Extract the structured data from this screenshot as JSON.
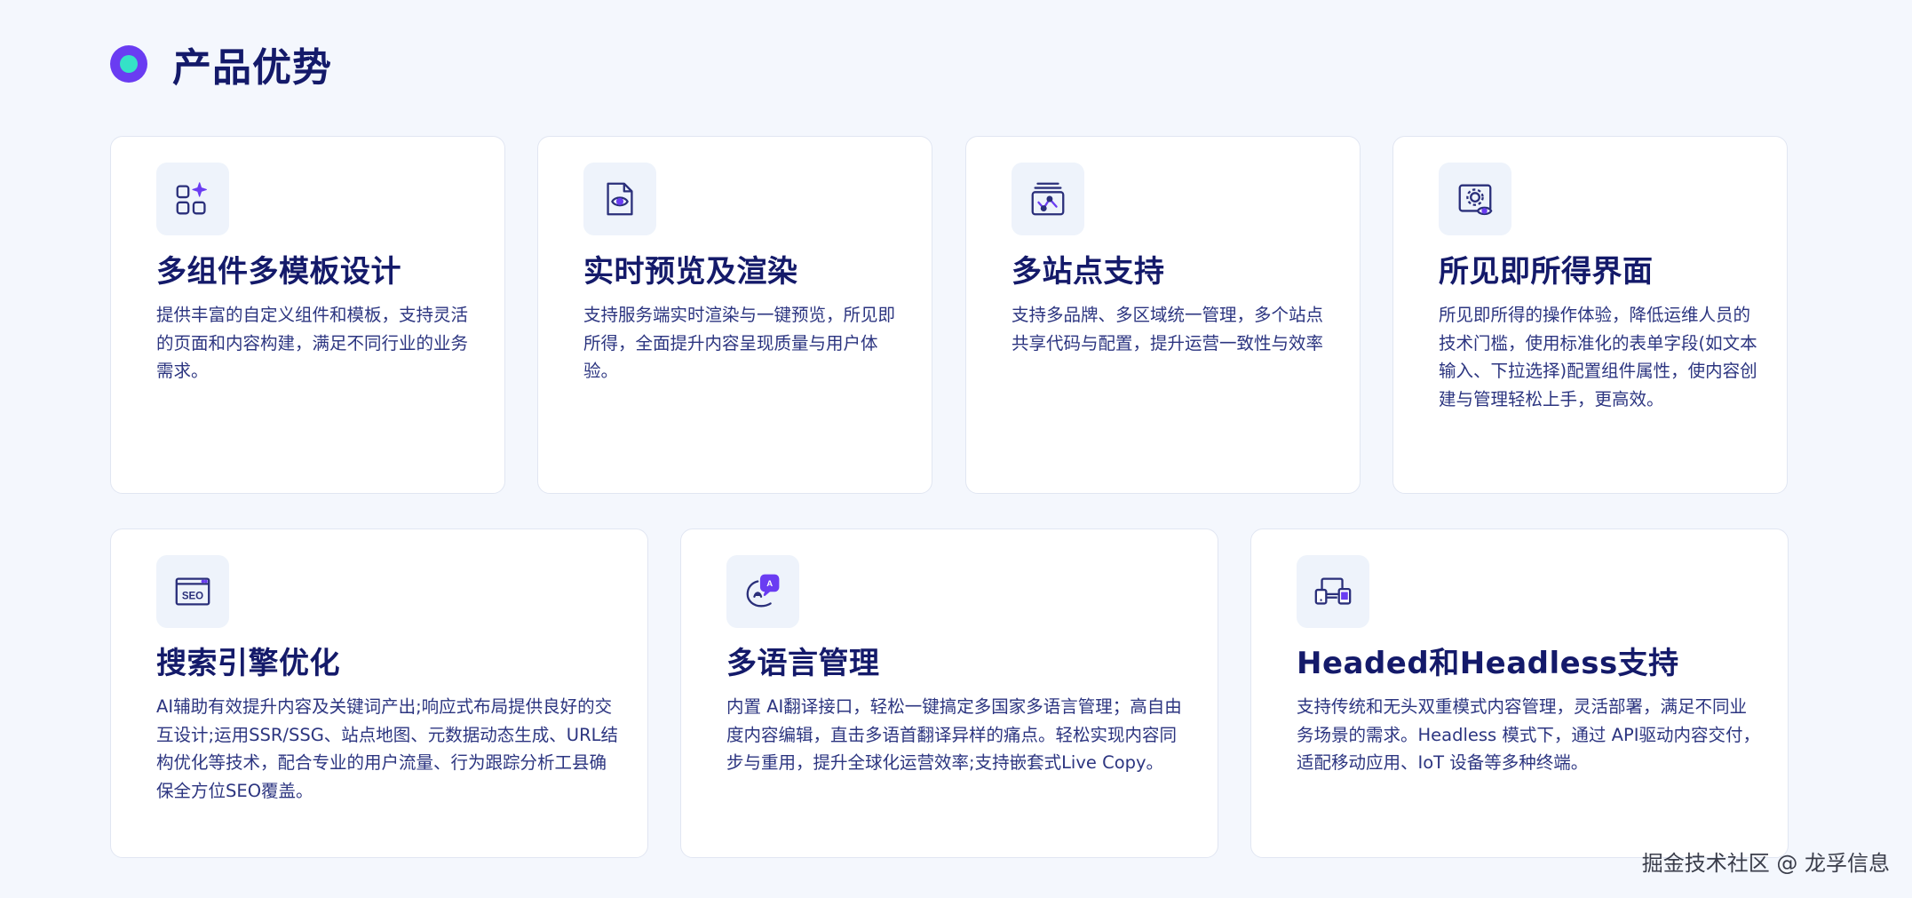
{
  "section": {
    "title": "产品优势"
  },
  "cards": [
    {
      "icon": "components-sparkle-icon",
      "title": "多组件多模板设计",
      "description": "提供丰富的自定义组件和模板，支持灵活的页面和内容构建，满足不同行业的业务需求。"
    },
    {
      "icon": "document-eye-icon",
      "title": "实时预览及渲染",
      "description": "支持服务端实时渲染与一键预览，所见即所得，全面提升内容呈现质量与用户体验。"
    },
    {
      "icon": "multi-site-chart-icon",
      "title": "多站点支持",
      "description": "支持多品牌、多区域统一管理，多个站点共享代码与配置，提升运营一致性与效率"
    },
    {
      "icon": "wysiwyg-settings-icon",
      "title": "所见即所得界面",
      "description": "所见即所得的操作体验，降低运维人员的技术门槛，使用标准化的表单字段(如文本输入、下拉选择)配置组件属性，使内容创建与管理轻松上手，更高效。"
    },
    {
      "icon": "seo-window-icon",
      "title": "搜索引擎优化",
      "description": "AI辅助有效提升内容及关键词产出;响应式布局提供良好的交互设计;运用SSR/SSG、站点地图、元数据动态生成、URL结构优化等技术，配合专业的用户流量、行为跟踪分析工县确保全方位SEO覆盖。"
    },
    {
      "icon": "translate-chat-icon",
      "title": "多语言管理",
      "description": "内置 AI翻译接口，轻松一键搞定多国家多语言管理；高自由度内容编辑，直击多语首翻译异样的痛点。轻松实现内容同步与重用，提升全球化运营效率;支持嵌套式Live Copy。"
    },
    {
      "icon": "multi-device-icon",
      "title": "Headed和Headless支持",
      "description": "支持传统和无头双重模式内容管理，灵活部署，满足不同业务场景的需求。Headless 模式下，通过 API驱动内容交付，适配移动应用、IoT 设备等多种终端。"
    }
  ],
  "colors": {
    "background": "#f4f7fd",
    "title": "#141a6a",
    "text": "#2c3580",
    "accent_purple": "#6a3cf2",
    "accent_teal": "#35e2c7",
    "icon_bg": "#eef3fb"
  },
  "watermark": "掘金技术社区 @ 龙孚信息"
}
